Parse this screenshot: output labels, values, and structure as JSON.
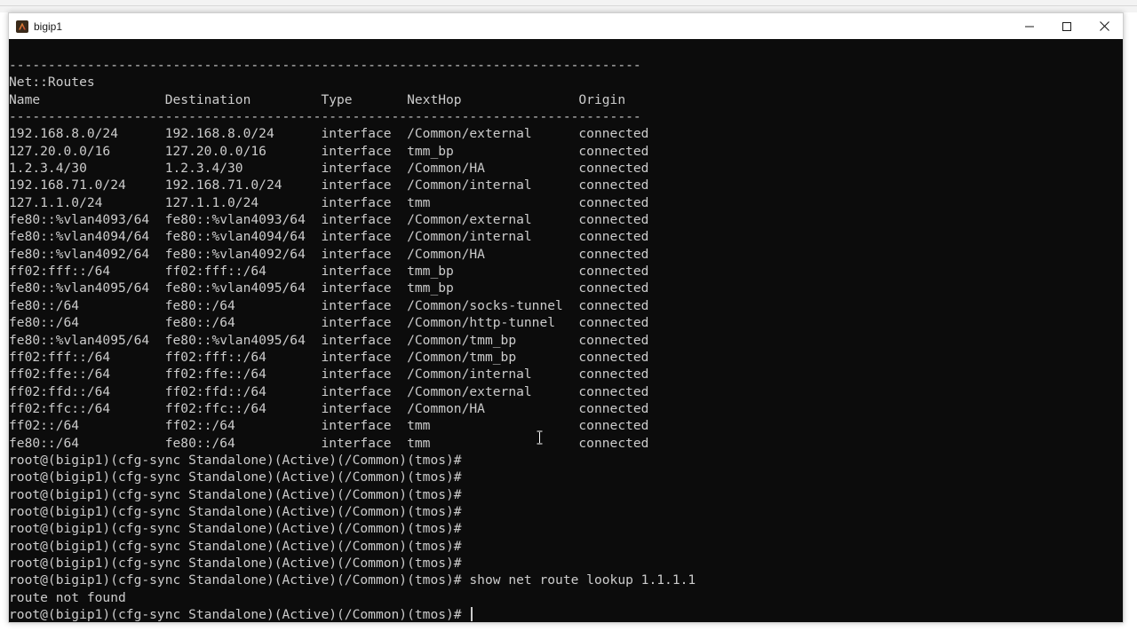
{
  "window": {
    "title": "bigip1",
    "controls": {
      "minimize": "minimize-icon",
      "maximize": "maximize-icon",
      "close": "close-icon"
    }
  },
  "terminal": {
    "colors": {
      "background": "#0c0c0c",
      "foreground": "#cccccc"
    },
    "lines": [
      "---------------------------------------------------------------------------------",
      "Net::Routes",
      "Name                Destination         Type       NextHop               Origin",
      "---------------------------------------------------------------------------------",
      "192.168.8.0/24      192.168.8.0/24      interface  /Common/external      connected",
      "127.20.0.0/16       127.20.0.0/16       interface  tmm_bp                connected",
      "1.2.3.4/30          1.2.3.4/30          interface  /Common/HA            connected",
      "192.168.71.0/24     192.168.71.0/24     interface  /Common/internal      connected",
      "127.1.1.0/24        127.1.1.0/24        interface  tmm                   connected",
      "fe80::%vlan4093/64  fe80::%vlan4093/64  interface  /Common/external      connected",
      "fe80::%vlan4094/64  fe80::%vlan4094/64  interface  /Common/internal      connected",
      "fe80::%vlan4092/64  fe80::%vlan4092/64  interface  /Common/HA            connected",
      "ff02:fff::/64       ff02:fff::/64       interface  tmm_bp                connected",
      "fe80::%vlan4095/64  fe80::%vlan4095/64  interface  tmm_bp                connected",
      "fe80::/64           fe80::/64           interface  /Common/socks-tunnel  connected",
      "fe80::/64           fe80::/64           interface  /Common/http-tunnel   connected",
      "fe80::%vlan4095/64  fe80::%vlan4095/64  interface  /Common/tmm_bp        connected",
      "ff02:fff::/64       ff02:fff::/64       interface  /Common/tmm_bp        connected",
      "ff02:ffe::/64       ff02:ffe::/64       interface  /Common/internal      connected",
      "ff02:ffd::/64       ff02:ffd::/64       interface  /Common/external      connected",
      "ff02:ffc::/64       ff02:ffc::/64       interface  /Common/HA            connected",
      "ff02::/64           ff02::/64           interface  tmm                   connected",
      "fe80::/64           fe80::/64           interface  tmm                   connected",
      "root@(bigip1)(cfg-sync Standalone)(Active)(/Common)(tmos)#",
      "root@(bigip1)(cfg-sync Standalone)(Active)(/Common)(tmos)#",
      "root@(bigip1)(cfg-sync Standalone)(Active)(/Common)(tmos)#",
      "root@(bigip1)(cfg-sync Standalone)(Active)(/Common)(tmos)#",
      "root@(bigip1)(cfg-sync Standalone)(Active)(/Common)(tmos)#",
      "root@(bigip1)(cfg-sync Standalone)(Active)(/Common)(tmos)#",
      "root@(bigip1)(cfg-sync Standalone)(Active)(/Common)(tmos)#",
      "root@(bigip1)(cfg-sync Standalone)(Active)(/Common)(tmos)# show net route lookup 1.1.1.1",
      "route not found"
    ],
    "prompt": "root@(bigip1)(cfg-sync Standalone)(Active)(/Common)(tmos)# "
  }
}
